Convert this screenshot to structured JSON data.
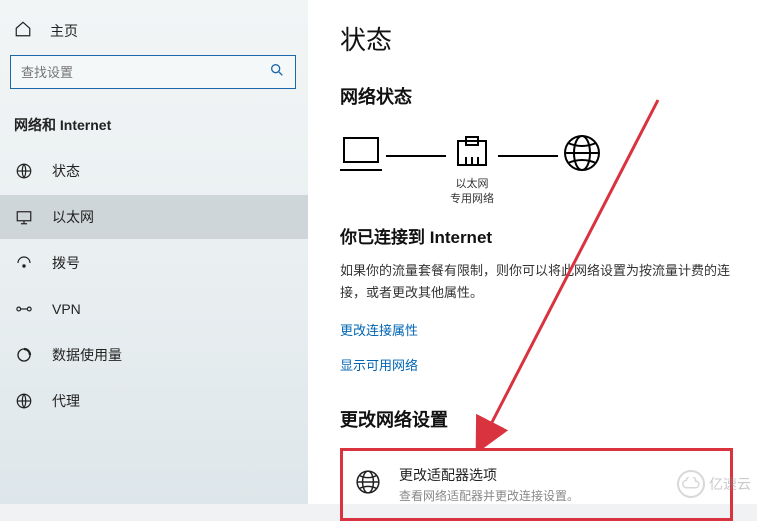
{
  "sidebar": {
    "home": "主页",
    "search_placeholder": "查找设置",
    "section_title": "网络和 Internet",
    "items": [
      {
        "label": "状态"
      },
      {
        "label": "以太网"
      },
      {
        "label": "拨号"
      },
      {
        "label": "VPN"
      },
      {
        "label": "数据使用量"
      },
      {
        "label": "代理"
      }
    ]
  },
  "main": {
    "title": "状态",
    "network_status_heading": "网络状态",
    "diagram": {
      "ethernet_label1": "以太网",
      "ethernet_label2": "专用网络"
    },
    "connected_heading": "你已连接到 Internet",
    "connected_body": "如果你的流量套餐有限制，则你可以将此网络设置为按流量计费的连接，或者更改其他属性。",
    "link_change_props": "更改连接属性",
    "link_show_networks": "显示可用网络",
    "change_settings_heading": "更改网络设置",
    "adapter": {
      "title": "更改适配器选项",
      "subtitle": "查看网络适配器并更改连接设置。"
    }
  },
  "watermark": "亿速云"
}
